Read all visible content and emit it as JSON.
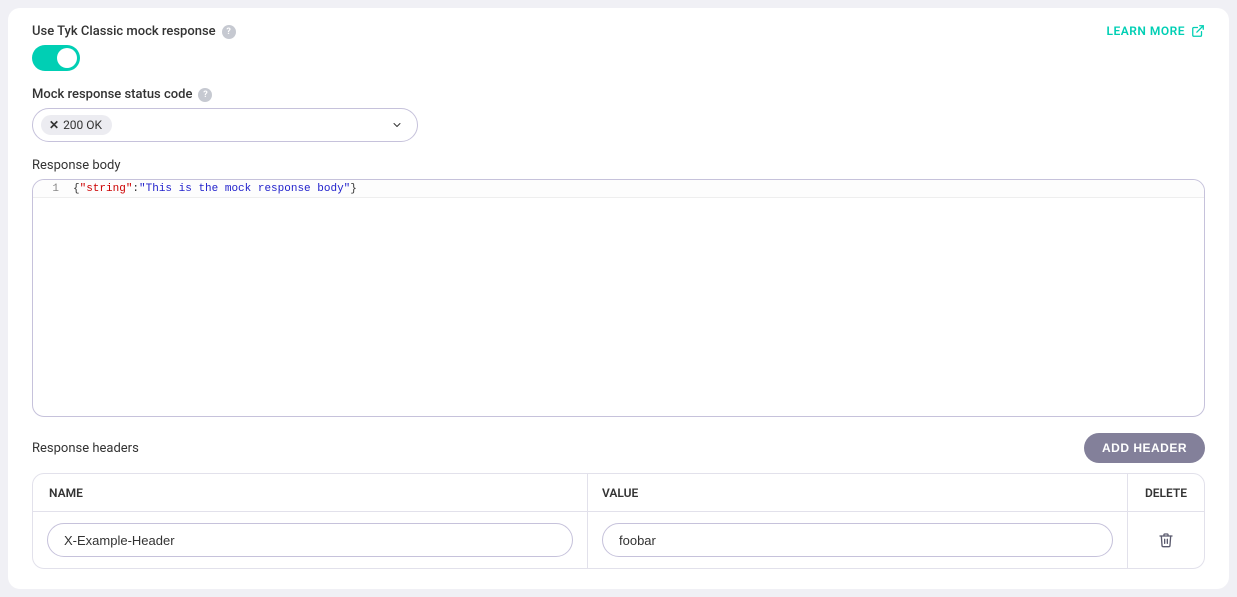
{
  "section": {
    "title": "Use Tyk Classic mock response",
    "learnMore": "LEARN MORE"
  },
  "statusCode": {
    "label": "Mock response status code",
    "value": "200 OK"
  },
  "responseBody": {
    "label": "Response body",
    "lineNumber": "1",
    "code": {
      "key": "\"string\"",
      "value": "\"This is the mock response body\""
    }
  },
  "headers": {
    "label": "Response headers",
    "addButton": "ADD HEADER",
    "columns": {
      "name": "NAME",
      "value": "VALUE",
      "delete": "DELETE"
    },
    "rows": [
      {
        "name": "X-Example-Header",
        "value": "foobar"
      }
    ]
  }
}
